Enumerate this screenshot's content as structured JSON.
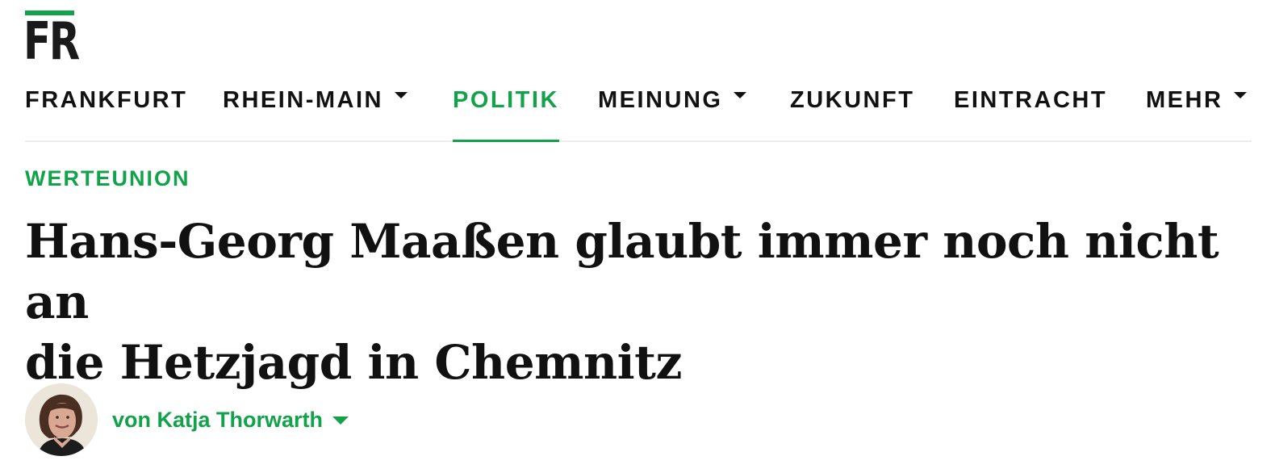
{
  "brand": {
    "logo_text": "FR",
    "accent_color": "#12a24a"
  },
  "nav": {
    "items": [
      {
        "label": "FRANKFURT",
        "has_dropdown": false,
        "active": false
      },
      {
        "label": "RHEIN-MAIN",
        "has_dropdown": true,
        "active": false
      },
      {
        "label": "POLITIK",
        "has_dropdown": false,
        "active": true
      },
      {
        "label": "MEINUNG",
        "has_dropdown": true,
        "active": false
      },
      {
        "label": "ZUKUNFT",
        "has_dropdown": false,
        "active": false
      },
      {
        "label": "EINTRACHT",
        "has_dropdown": false,
        "active": false
      },
      {
        "label": "MEHR",
        "has_dropdown": true,
        "active": false
      }
    ]
  },
  "article": {
    "kicker": "WERTEUNION",
    "headline_line1": "Hans-Georg Maaßen glaubt immer noch nicht an",
    "headline_line2": "die Hetzjagd in Chemnitz",
    "author": {
      "byline": "von Katja Thorwarth",
      "avatar_icon": "author-portrait",
      "dropdown_icon": "chevron-down-icon"
    }
  }
}
